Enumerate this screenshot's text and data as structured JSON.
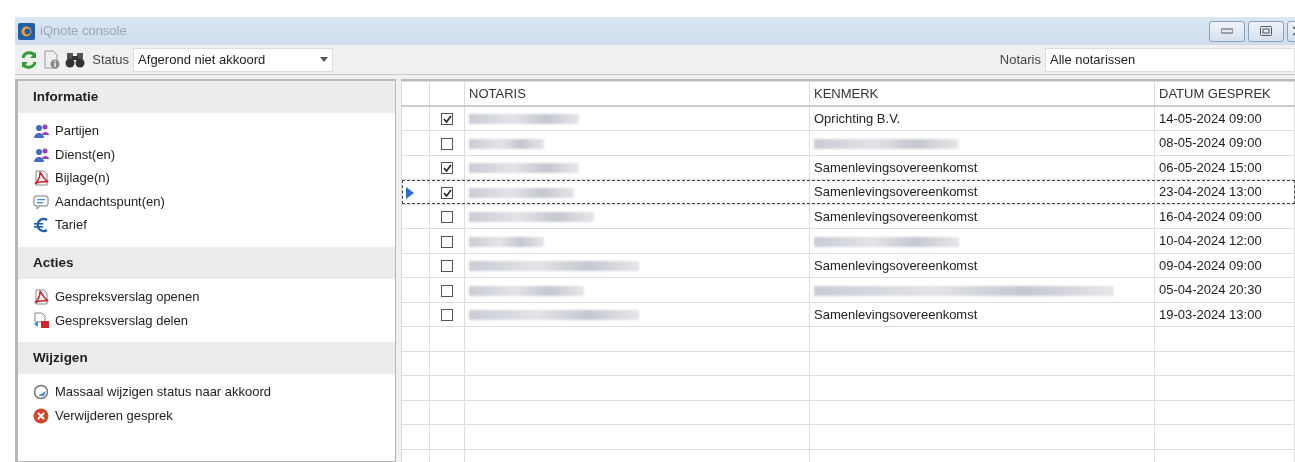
{
  "window": {
    "title": "iQnote console"
  },
  "toolbar": {
    "status_label": "Status",
    "status_value": "Afgerond niet akkoord",
    "notaris_label": "Notaris",
    "notaris_value": "Alle notarissen"
  },
  "sidebar": {
    "sections": [
      {
        "title": "Informatie",
        "items": [
          {
            "kind": "people",
            "label": "Partijen"
          },
          {
            "kind": "people",
            "label": "Dienst(en)"
          },
          {
            "kind": "pdf",
            "label": "Bijlage(n)"
          },
          {
            "kind": "comment",
            "label": "Aandachtspunt(en)"
          },
          {
            "kind": "euro",
            "label": "Tarief"
          }
        ]
      },
      {
        "title": "Acties",
        "items": [
          {
            "kind": "pdf",
            "label": "Gespreksverslag openen"
          },
          {
            "kind": "share",
            "label": "Gespreksverslag delen"
          }
        ]
      },
      {
        "title": "Wijzigen",
        "items": [
          {
            "kind": "status",
            "label": "Massaal wijzigen status naar akkoord"
          },
          {
            "kind": "delete",
            "label": "Verwijderen gesprek"
          }
        ]
      }
    ]
  },
  "table": {
    "columns": [
      "NOTARIS",
      "KENMERK",
      "DATUM GESPREK"
    ],
    "rows": [
      {
        "checked": true,
        "current": false,
        "kenmerk": "Oprichting B.V.",
        "datum": "14-05-2024 09:00"
      },
      {
        "checked": false,
        "current": false,
        "kenmerk_redacted": true,
        "datum": "08-05-2024 09:00"
      },
      {
        "checked": true,
        "current": false,
        "kenmerk": "Samenlevingsovereenkomst",
        "datum": "06-05-2024 15:00"
      },
      {
        "checked": true,
        "current": true,
        "kenmerk": "Samenlevingsovereenkomst",
        "datum": "23-04-2024 13:00"
      },
      {
        "checked": false,
        "current": false,
        "kenmerk": "Samenlevingsovereenkomst",
        "datum": "16-04-2024 09:00"
      },
      {
        "checked": false,
        "current": false,
        "kenmerk_redacted": true,
        "datum": "10-04-2024 12:00"
      },
      {
        "checked": false,
        "current": false,
        "kenmerk": "Samenlevingsovereenkomst",
        "datum": "09-04-2024 09:00"
      },
      {
        "checked": false,
        "current": false,
        "kenmerk_redacted": true,
        "datum": "05-04-2024 20:30"
      },
      {
        "checked": false,
        "current": false,
        "kenmerk": "Samenlevingsovereenkomst",
        "datum": "19-03-2024 13:00"
      }
    ]
  }
}
